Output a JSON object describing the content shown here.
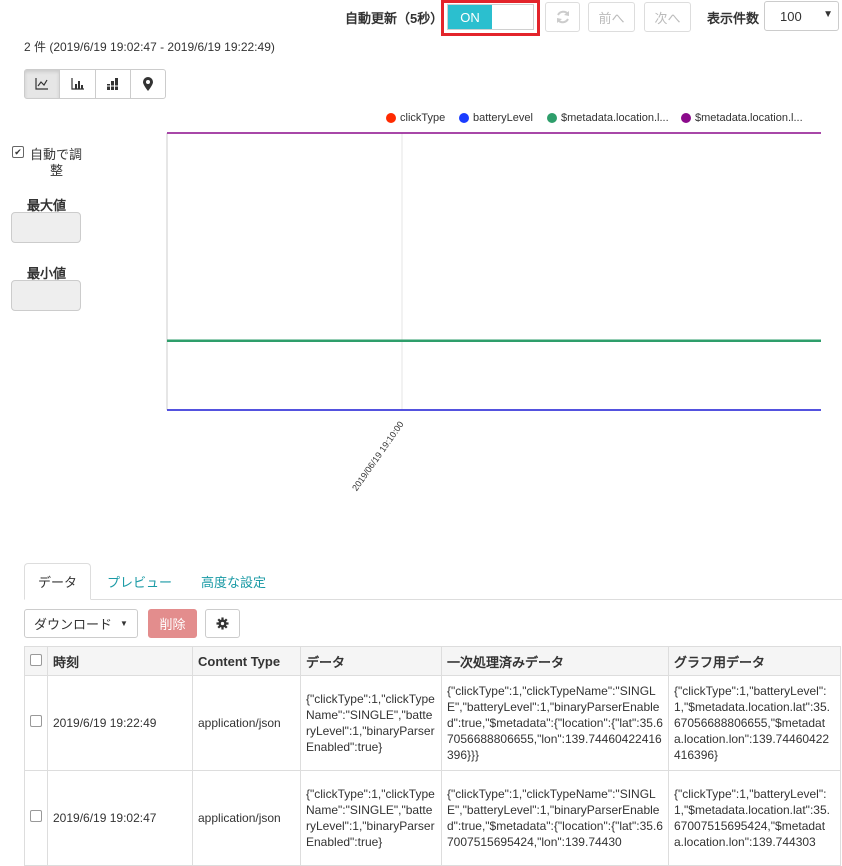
{
  "header": {
    "auto_update_label": "自動更新（5秒）",
    "toggle_label": "ON",
    "prev_label": "前へ",
    "next_label": "次へ",
    "page_size_label": "表示件数",
    "page_size_value": "100"
  },
  "summary": "2 件 (2019/6/19 19:02:47 - 2019/6/19 19:22:49)",
  "chart_types": [
    "line-chart-icon",
    "bar-chart-icon",
    "stacked-bar-chart-icon",
    "map-pin-icon"
  ],
  "sidebar": {
    "auto_adjust_label_line1": "自動で調",
    "auto_adjust_label_line2": "整",
    "max_label": "最大値",
    "min_label": "最小値"
  },
  "chart_data": {
    "type": "line",
    "series": [
      {
        "name": "clickType",
        "color": "#ff2a00",
        "values": [
          1,
          1
        ]
      },
      {
        "name": "batteryLevel",
        "color": "#1a3cff",
        "values": [
          1,
          1
        ]
      },
      {
        "name": "$metadata.location.l...",
        "color": "#2e9e6b",
        "values": [
          35.67,
          35.67
        ]
      },
      {
        "name": "$metadata.location.l...",
        "color": "#8b0a8b",
        "values": [
          139.74,
          139.74
        ]
      }
    ],
    "x_tick_labels": [
      "2019/06/19 19:10:00"
    ],
    "ylim": [
      1,
      139.74
    ],
    "grid": true,
    "legend_position": "top-right"
  },
  "tabs": [
    {
      "label": "データ"
    },
    {
      "label": "プレビュー"
    },
    {
      "label": "高度な設定"
    }
  ],
  "toolbar": {
    "download_label": "ダウンロード",
    "delete_label": "削除"
  },
  "table": {
    "columns": [
      "時刻",
      "Content Type",
      "データ",
      "一次処理済みデータ",
      "グラフ用データ"
    ],
    "rows": [
      {
        "time": "2019/6/19 19:22:49",
        "content_type": "application/json",
        "data": "{\"clickType\":1,\"clickTypeName\":\"SINGLE\",\"batteryLevel\":1,\"binaryParserEnabled\":true}",
        "processed": "{\"clickType\":1,\"clickTypeName\":\"SINGLE\",\"batteryLevel\":1,\"binaryParserEnabled\":true,\"$metadata\":{\"location\":{\"lat\":35.67056688806655,\"lon\":139.74460422416396}}}",
        "graph": "{\"clickType\":1,\"batteryLevel\":1,\"$metadata.location.lat\":35.67056688806655,\"$metadata.location.lon\":139.74460422416396}"
      },
      {
        "time": "2019/6/19 19:02:47",
        "content_type": "application/json",
        "data": "{\"clickType\":1,\"clickTypeName\":\"SINGLE\",\"batteryLevel\":1,\"binaryParserEnabled\":true}",
        "processed": "{\"clickType\":1,\"clickTypeName\":\"SINGLE\",\"batteryLevel\":1,\"binaryParserEnabled\":true,\"$metadata\":{\"location\":{\"lat\":35.67007515695424,\"lon\":139.74430",
        "graph": "{\"clickType\":1,\"batteryLevel\":1,\"$metadata.location.lat\":35.67007515695424,\"$metadata.location.lon\":139.744303"
      }
    ]
  }
}
